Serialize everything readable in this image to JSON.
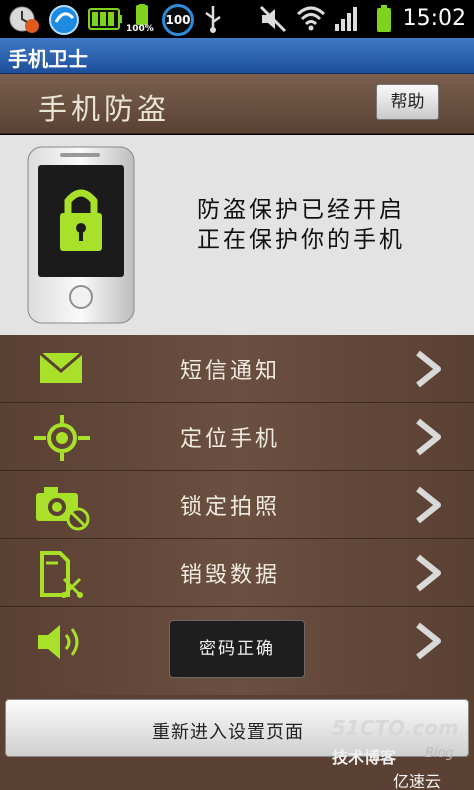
{
  "status_bar": {
    "time": "15:02",
    "battery_small_label": "100%",
    "ring_badge": "100",
    "icons": [
      "clock-badge-icon",
      "browser-icon",
      "battery-status-icon",
      "percent-battery-icon",
      "ring-counter-icon",
      "usb-icon",
      "mute-icon",
      "wifi-icon",
      "signal-icon",
      "battery-icon"
    ]
  },
  "app_bar": {
    "title": "手机卫士"
  },
  "header": {
    "title": "手机防盗",
    "help_label": "帮助"
  },
  "protection": {
    "line1": "防盗保护已经开启",
    "line2": "正在保护你的手机",
    "icon": "locked-phone-icon"
  },
  "menu": {
    "items": [
      {
        "label": "短信通知",
        "icon": "envelope-icon"
      },
      {
        "label": "定位手机",
        "icon": "location-target-icon"
      },
      {
        "label": "锁定拍照",
        "icon": "camera-lock-icon"
      },
      {
        "label": "销毁数据",
        "icon": "file-shred-icon"
      },
      {
        "label": "",
        "icon": "speaker-icon"
      }
    ]
  },
  "toast": {
    "text": "密码正确"
  },
  "bottom": {
    "reset_label": "重新进入设置页面"
  },
  "watermark": {
    "site": "51CTO.com",
    "blog": "技术博客",
    "blog_en": "Blog",
    "brand": "亿速云"
  },
  "colors": {
    "accent_green": "#a8e02a",
    "header_brown": "#6b4f40",
    "app_bar_blue": "#2b63b0"
  }
}
